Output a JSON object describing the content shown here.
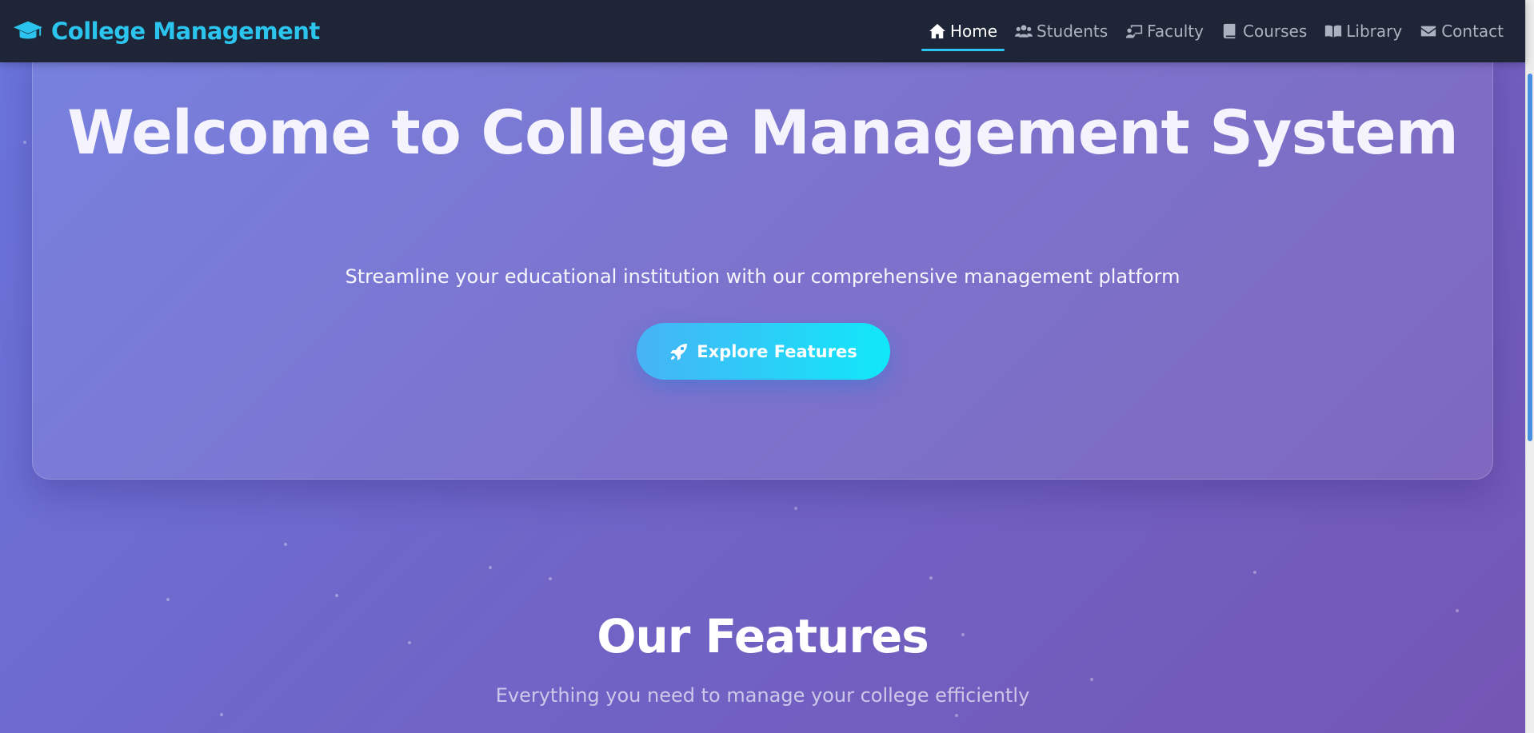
{
  "brand": {
    "name": "College Management",
    "icon": "graduation-cap-icon",
    "color": "#2bc4ee"
  },
  "nav": {
    "items": [
      {
        "label": "Home",
        "icon": "home-icon",
        "active": true
      },
      {
        "label": "Students",
        "icon": "users-icon",
        "active": false
      },
      {
        "label": "Faculty",
        "icon": "chalkboard-teacher-icon",
        "active": false
      },
      {
        "label": "Courses",
        "icon": "book-icon",
        "active": false
      },
      {
        "label": "Library",
        "icon": "open-book-icon",
        "active": false
      },
      {
        "label": "Contact",
        "icon": "envelope-icon",
        "active": false
      }
    ]
  },
  "hero": {
    "title": "Welcome to College Management System",
    "subtitle": "Streamline your educational institution with our comprehensive management platform",
    "cta_label": "Explore Features",
    "cta_icon": "rocket-icon"
  },
  "features": {
    "title": "Our Features",
    "subtitle": "Everything you need to manage your college efficiently"
  },
  "colors": {
    "navbar_bg": "#1e2536",
    "accent": "#2bc4ee",
    "cta_gradient_start": "#47b3f6",
    "cta_gradient_end": "#10e8f8",
    "background_start": "#6a76dd",
    "background_end": "#7456b4"
  }
}
